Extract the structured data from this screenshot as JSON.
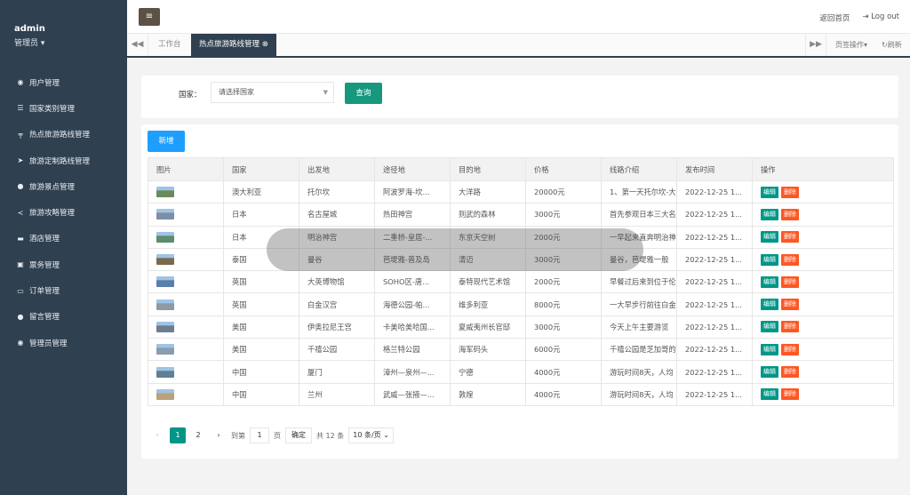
{
  "sidebar": {
    "user_name": "admin",
    "user_role": "管理员",
    "items": [
      {
        "label": "用户管理",
        "icon": "user-circle-icon"
      },
      {
        "label": "国家类别管理",
        "icon": "sliders-icon"
      },
      {
        "label": "热点旅游路线管理",
        "icon": "signpost-icon"
      },
      {
        "label": "旅游定制路线管理",
        "icon": "paper-plane-icon"
      },
      {
        "label": "旅游景点管理",
        "icon": "map-pin-icon"
      },
      {
        "label": "旅游攻略管理",
        "icon": "share-icon"
      },
      {
        "label": "酒店管理",
        "icon": "car-icon"
      },
      {
        "label": "票务管理",
        "icon": "id-card-icon"
      },
      {
        "label": "订单管理",
        "icon": "credit-card-icon"
      },
      {
        "label": "留言管理",
        "icon": "comment-icon"
      },
      {
        "label": "管理员管理",
        "icon": "user-circle-icon"
      }
    ]
  },
  "header": {
    "back_home": "返回首页",
    "logout": "Log out"
  },
  "tabs": {
    "workspace": "工作台",
    "active": "热点旅游路线管理",
    "tab_ops": "页签操作",
    "refresh": "刷新"
  },
  "search": {
    "label": "国家：",
    "select_value": "请选择国家",
    "query_label": "查询"
  },
  "table": {
    "add_label": "新增",
    "columns": [
      "图片",
      "国家",
      "出发地",
      "途径地",
      "目的地",
      "价格",
      "线路介绍",
      "发布时间",
      "操作"
    ],
    "edit_label": "编辑",
    "delete_label": "删除",
    "rows": [
      {
        "country": "澳大利亚",
        "from": "托尔坎",
        "via": "阿波罗海-坎...",
        "to": "大洋路",
        "price": "20000元",
        "intro": "1、第一天托尔坎-大洋路",
        "time": "2022-12-25 1...",
        "thumb_color": "#6a8a5c"
      },
      {
        "country": "日本",
        "from": "名古屋城",
        "via": "热田神宫",
        "to": "则武的森林",
        "price": "3000元",
        "intro": "首先参观日本三大名城",
        "time": "2022-12-25 1...",
        "thumb_color": "#7d8fa6"
      },
      {
        "country": "日本",
        "from": "明治神宫",
        "via": "二重桥-皇居-...",
        "to": "东京天空树",
        "price": "2000元",
        "intro": "一早起来直奔明治神宫",
        "time": "2022-12-25 1...",
        "thumb_color": "#5e8c6e"
      },
      {
        "country": "泰国",
        "from": "曼谷",
        "via": "芭堤雅-普及岛",
        "to": "清迈",
        "price": "3000元",
        "intro": "曼谷，芭堤雅一般",
        "time": "2022-12-25 1...",
        "thumb_color": "#7a6a4e"
      },
      {
        "country": "英国",
        "from": "大英博物馆",
        "via": "SOHO区-唐...",
        "to": "泰特现代艺术馆",
        "price": "2000元",
        "intro": "早餐过后来到位于伦敦",
        "time": "2022-12-25 1...",
        "thumb_color": "#5a7fa8"
      },
      {
        "country": "英国",
        "from": "白金汉宫",
        "via": "海德公园-帕...",
        "to": "维多利亚",
        "price": "8000元",
        "intro": "一大早步行前往白金汉宫",
        "time": "2022-12-25 1...",
        "thumb_color": "#8d9aa3"
      },
      {
        "country": "美国",
        "from": "伊奥拉尼王宫",
        "via": "卡美哈美哈国...",
        "to": "夏威夷州长官邸",
        "price": "3000元",
        "intro": "今天上午主要游览",
        "time": "2022-12-25 1...",
        "thumb_color": "#6f7e8e"
      },
      {
        "country": "美国",
        "from": "千禧公园",
        "via": "格兰特公园",
        "to": "海军码头",
        "price": "6000元",
        "intro": "千禧公园是芝加哥的",
        "time": "2022-12-25 1...",
        "thumb_color": "#8a9cb0"
      },
      {
        "country": "中国",
        "from": "厦门",
        "via": "漳州—泉州—...",
        "to": "宁德",
        "price": "4000元",
        "intro": "游玩时间8天，人均",
        "time": "2022-12-25 1...",
        "thumb_color": "#5f7f94"
      },
      {
        "country": "中国",
        "from": "兰州",
        "via": "武威—张掖—...",
        "to": "敦煌",
        "price": "4000元",
        "intro": "游玩时间8天，人均",
        "time": "2022-12-25 1...",
        "thumb_color": "#b9a27a"
      }
    ]
  },
  "pager": {
    "pages": [
      "1",
      "2"
    ],
    "goto_label": "到第",
    "goto_value": "1",
    "page_unit": "页",
    "confirm_label": "确定",
    "total": "共 12 条",
    "page_size": "10 条/页"
  },
  "colors": {
    "sidebar_bg": "#2f4050",
    "primary": "#009688",
    "query_button": "#16987e",
    "add_button": "#1e9fff",
    "delete_button": "#ff5722"
  }
}
